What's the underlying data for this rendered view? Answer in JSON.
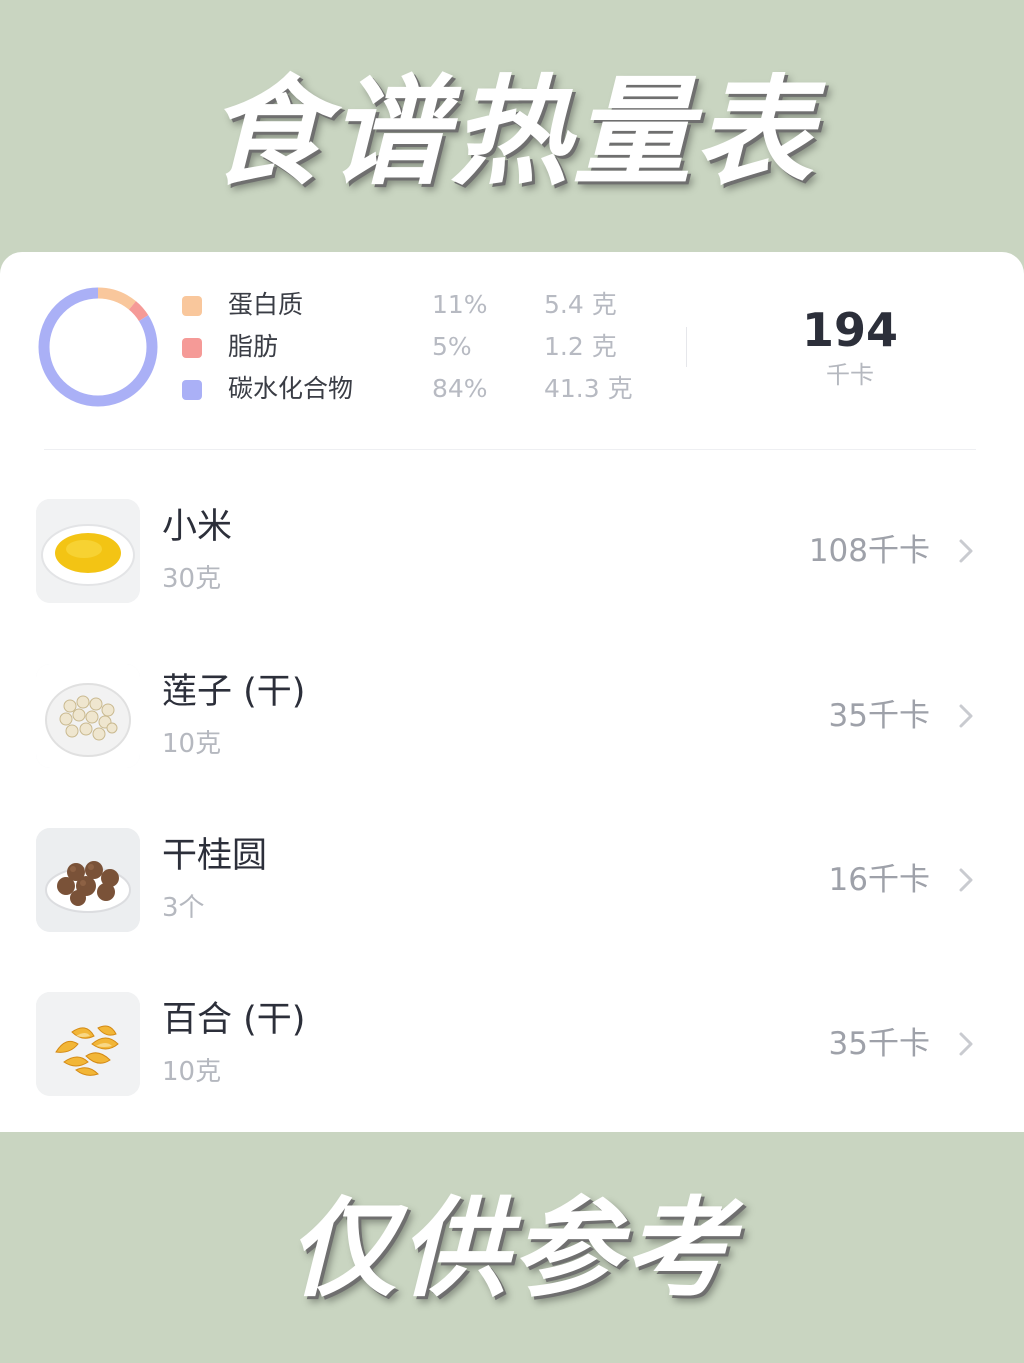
{
  "header": {
    "title": "食谱热量表"
  },
  "footer": {
    "text": "仅供参考"
  },
  "summary": {
    "nutrients": [
      {
        "name": "蛋白质",
        "percent": "11%",
        "grams": "5.4 克",
        "color": "#f9c79c",
        "share": 11
      },
      {
        "name": "脂肪",
        "percent": "5%",
        "grams": "1.2 克",
        "color": "#f59a97",
        "share": 5
      },
      {
        "name": "碳水化合物",
        "percent": "84%",
        "grams": "41.3 克",
        "color": "#aab0f6",
        "share": 84
      }
    ],
    "total_value": "194",
    "total_unit": "千卡"
  },
  "foods": [
    {
      "name": "小米",
      "amount": "30克",
      "kcal": "108千卡",
      "icon": "millet-icon"
    },
    {
      "name": "莲子 (干)",
      "amount": "10克",
      "kcal": "35千卡",
      "icon": "lotus-seed-icon"
    },
    {
      "name": "干桂圆",
      "amount": "3个",
      "kcal": "16千卡",
      "icon": "dried-longan-icon"
    },
    {
      "name": "百合 (干)",
      "amount": "10克",
      "kcal": "35千卡",
      "icon": "dried-lily-icon"
    }
  ],
  "colors": {
    "background": "#c9d5c1",
    "card": "#ffffff",
    "text_primary": "#2c2f3a",
    "text_muted": "#b5b8bf"
  }
}
